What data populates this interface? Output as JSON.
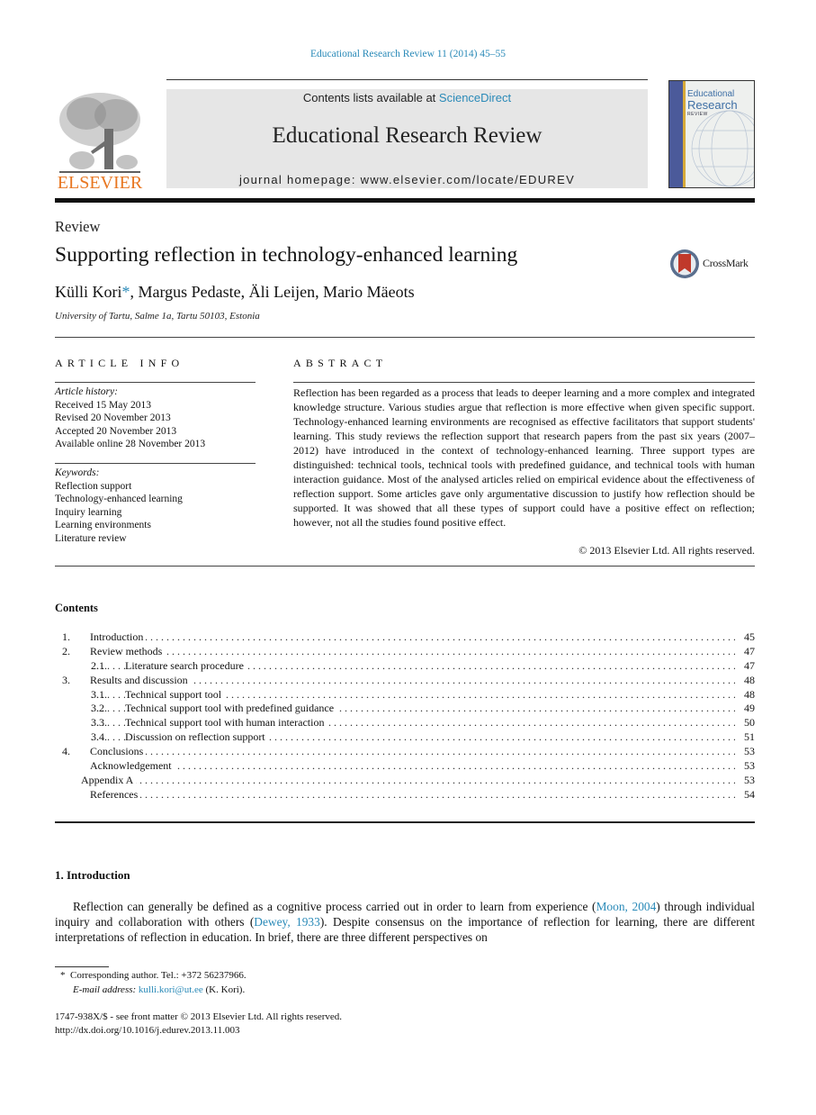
{
  "journal_ref": "Educational Research Review 11 (2014) 45–55",
  "masthead": {
    "publisher": "ELSEVIER",
    "contents_prefix": "Contents lists available at ",
    "contents_link": "ScienceDirect",
    "journal_title": "Educational Research Review",
    "homepage": "journal homepage: www.elsevier.com/locate/EDUREV",
    "cover": {
      "line1": "Educational",
      "line2": "Research",
      "line3": "REVIEW"
    }
  },
  "article": {
    "type": "Review",
    "title": "Supporting reflection in technology-enhanced learning",
    "crossmark": "CrossMark",
    "first_author": "Külli Kori",
    "author_marker": "*",
    "other_authors": ", Margus Pedaste, Äli Leijen, Mario Mäeots",
    "affiliation": "University of Tartu, Salme 1a, Tartu 50103, Estonia"
  },
  "article_info": {
    "heading": "ARTICLE INFO",
    "history_label": "Article history:",
    "history": [
      "Received 15 May 2013",
      "Revised 20 November 2013",
      "Accepted 20 November 2013",
      "Available online 28 November 2013"
    ],
    "keywords_label": "Keywords:",
    "keywords": [
      "Reflection support",
      "Technology-enhanced learning",
      "Inquiry learning",
      "Learning environments",
      "Literature review"
    ]
  },
  "abstract": {
    "heading": "ABSTRACT",
    "text": "Reflection has been regarded as a process that leads to deeper learning and a more complex and integrated knowledge structure. Various studies argue that reflection is more effective when given specific support. Technology-enhanced learning environments are recognised as effective facilitators that support students' learning. This study reviews the reflection support that research papers from the past six years (2007–2012) have introduced in the context of technology-enhanced learning. Three support types are distinguished: technical tools, technical tools with predefined guidance, and technical tools with human interaction guidance. Most of the analysed articles relied on empirical evidence about the effectiveness of reflection support. Some articles gave only argumentative discussion to justify how reflection should be supported. It was showed that all these types of support could have a positive effect on reflection; however, not all the studies found positive effect.",
    "copyright": "© 2013 Elsevier Ltd. All rights reserved."
  },
  "contents": {
    "heading": "Contents",
    "items": [
      {
        "num": "1.",
        "label": "Introduction",
        "page": "45",
        "level": 1
      },
      {
        "num": "2.",
        "label": "Review methods",
        "page": "47",
        "level": 1
      },
      {
        "num": "2.1.",
        "label": "Literature search procedure",
        "page": "47",
        "level": 2
      },
      {
        "num": "3.",
        "label": "Results and discussion",
        "page": "48",
        "level": 1
      },
      {
        "num": "3.1.",
        "label": "Technical support tool",
        "page": "48",
        "level": 2
      },
      {
        "num": "3.2.",
        "label": "Technical support tool with predefined guidance",
        "page": "49",
        "level": 2
      },
      {
        "num": "3.3.",
        "label": "Technical support tool with human interaction",
        "page": "50",
        "level": 2
      },
      {
        "num": "3.4.",
        "label": "Discussion on reflection support",
        "page": "51",
        "level": 2
      },
      {
        "num": "4.",
        "label": "Conclusions",
        "page": "53",
        "level": 1
      },
      {
        "num": "",
        "label": "Acknowledgement",
        "page": "53",
        "level": 1
      },
      {
        "num": "",
        "label": "Appendix A",
        "page": "53",
        "level": 0
      },
      {
        "num": "",
        "label": "References",
        "page": "54",
        "level": 1
      }
    ]
  },
  "introduction": {
    "heading": "1. Introduction",
    "text_1": "Reflection can generally be defined as a cognitive process carried out in order to learn from experience (",
    "cite_1": "Moon, 2004",
    "text_2": ") through individual inquiry and collaboration with others (",
    "cite_2": "Dewey, 1933",
    "text_3": "). Despite consensus on the importance of reflection for learning, there are different interpretations of reflection in education. In brief, there are three different perspectives on"
  },
  "footnotes": {
    "marker": "*",
    "corresponding": "Corresponding author. Tel.: +372 56237966.",
    "email_label": "E-mail address:",
    "email": "kulli.kori@ut.ee",
    "email_suffix": " (K. Kori).",
    "issn": "1747-938X/$ - see front matter © 2013 Elsevier Ltd. All rights reserved.",
    "doi": "http://dx.doi.org/10.1016/j.edurev.2013.11.003"
  }
}
